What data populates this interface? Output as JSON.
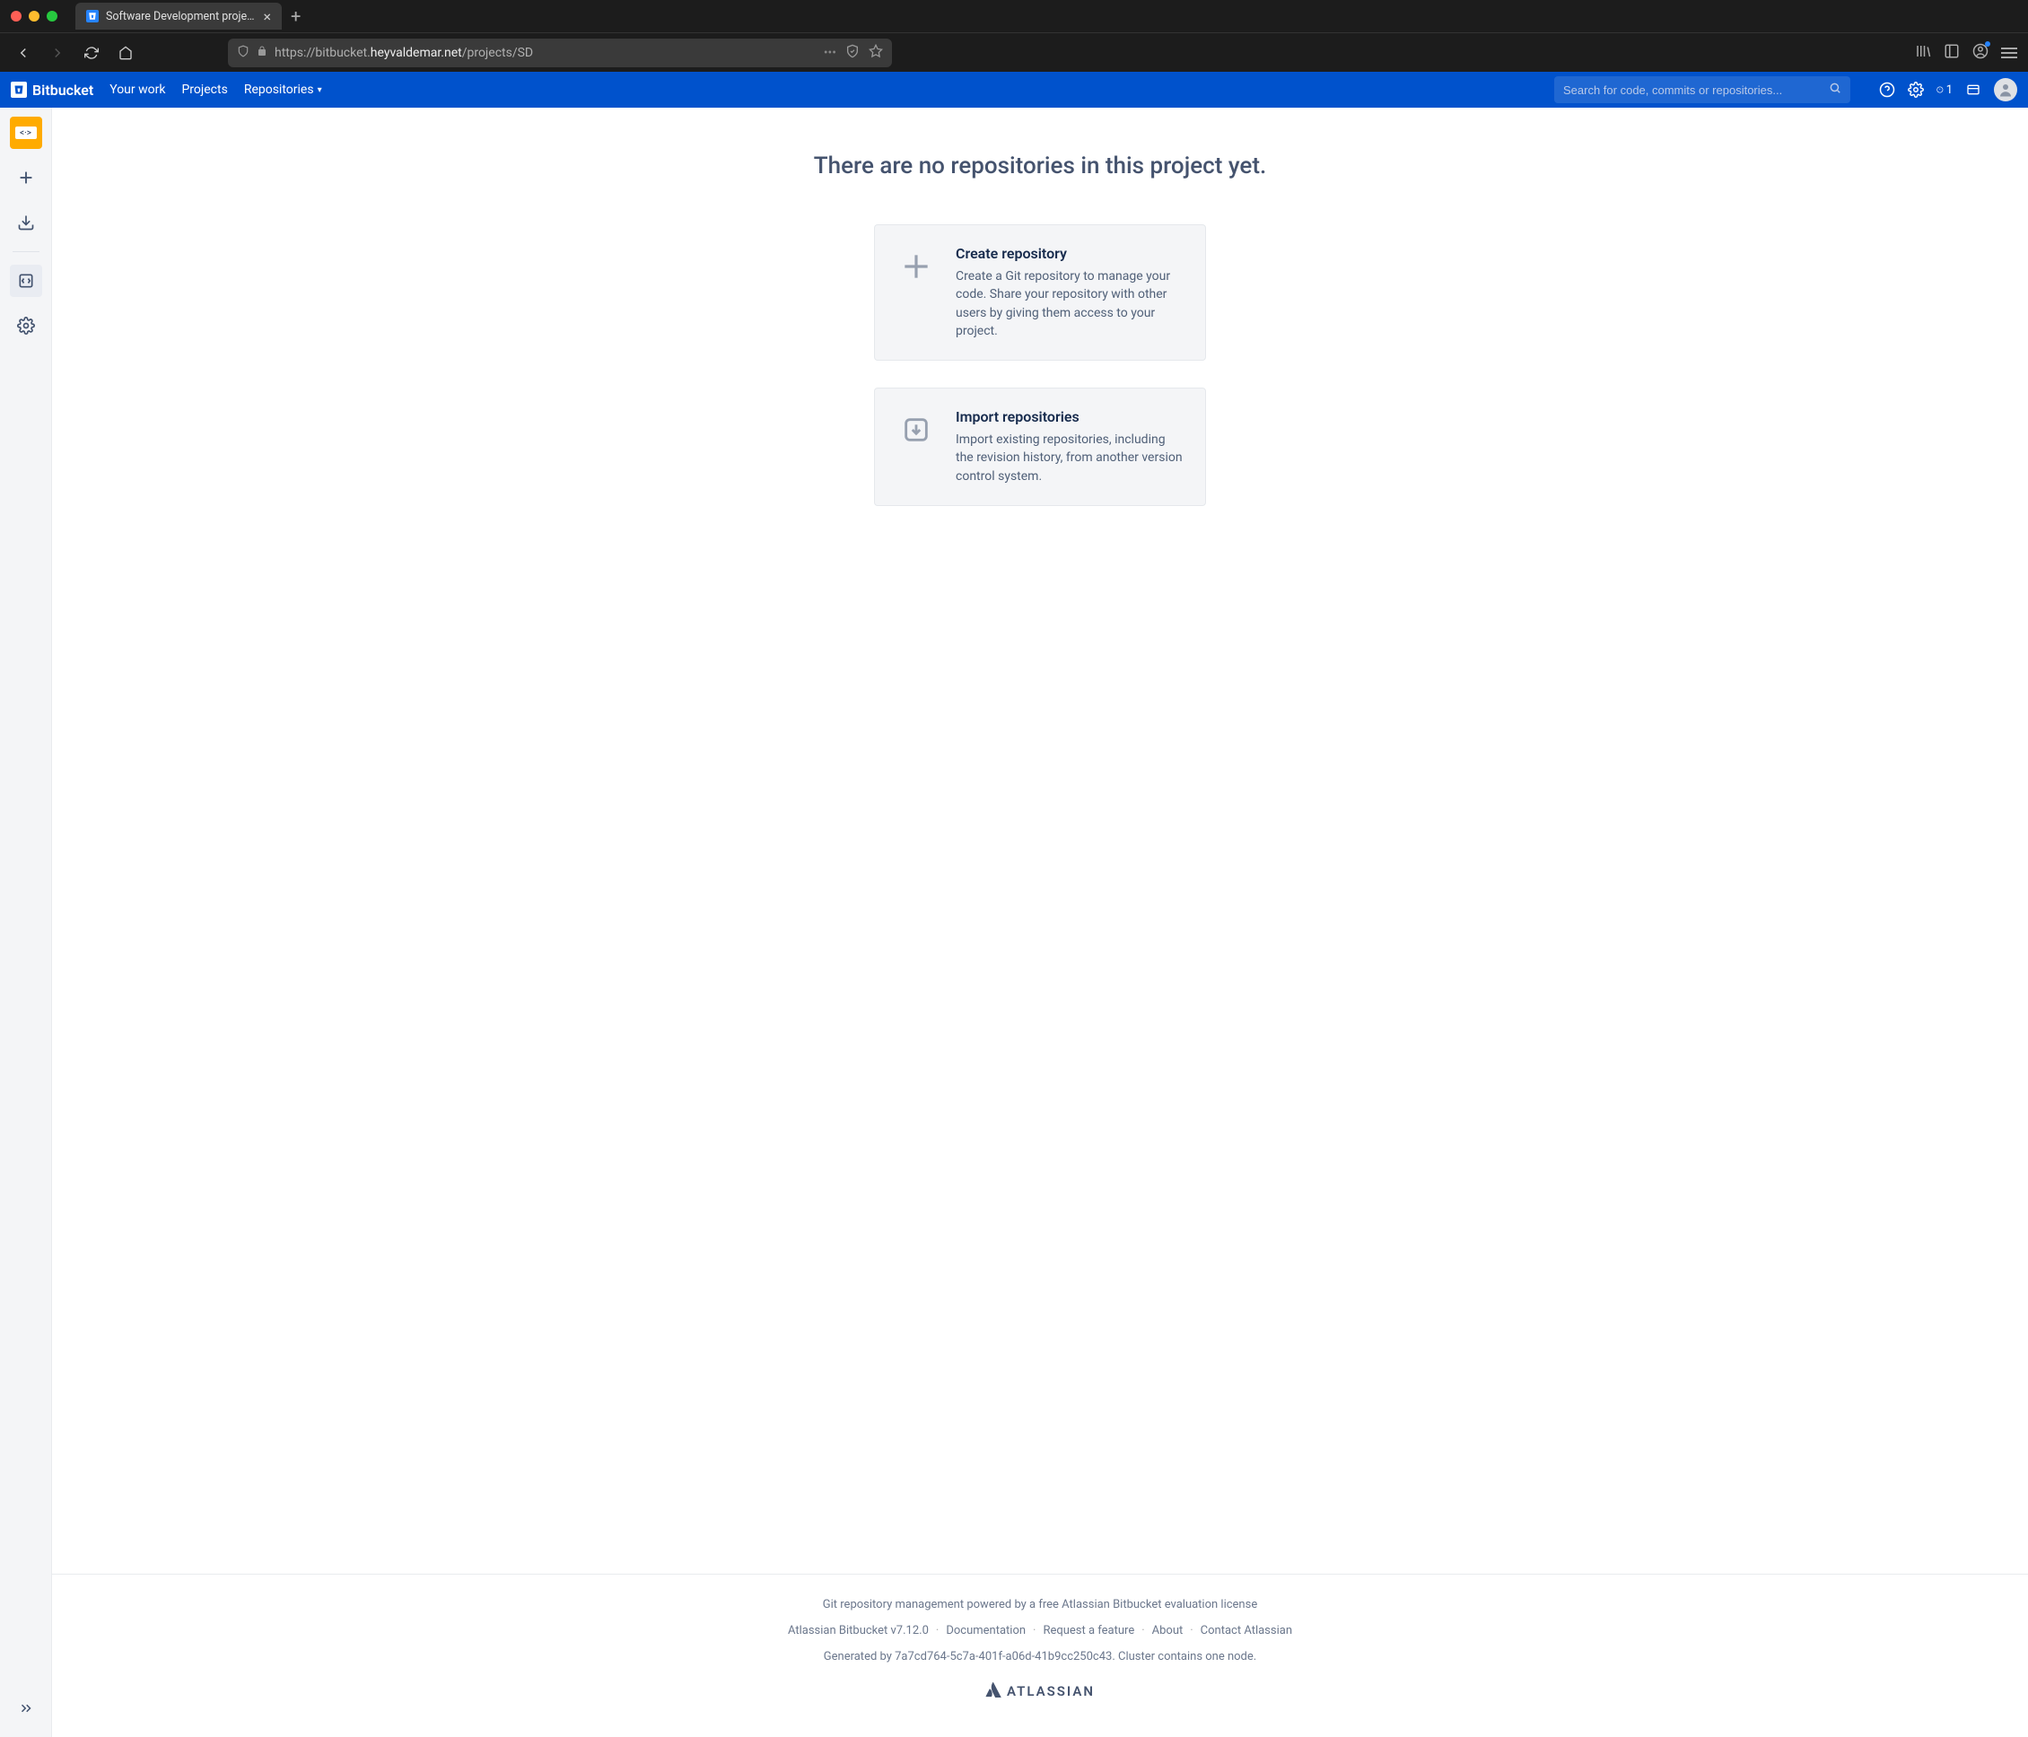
{
  "browser": {
    "tab_title": "Software Development project",
    "url_prefix": "https://bitbucket.",
    "url_domain": "heyvaldemar.net",
    "url_path": "/projects/SD"
  },
  "header": {
    "product": "Bitbucket",
    "nav": {
      "your_work": "Your work",
      "projects": "Projects",
      "repositories": "Repositories"
    },
    "search_placeholder": "Search for code, commits or repositories...",
    "inbox_count": "1"
  },
  "main": {
    "heading": "There are no repositories in this project yet.",
    "create": {
      "title": "Create repository",
      "desc": "Create a Git repository to manage your code. Share your repository with other users by giving them access to your project."
    },
    "import": {
      "title": "Import repositories",
      "desc": "Import existing repositories, including the revision history, from another version control system."
    }
  },
  "footer": {
    "powered": "Git repository management powered by a free Atlassian Bitbucket evaluation license",
    "version": "Atlassian Bitbucket v7.12.0",
    "links": {
      "documentation": "Documentation",
      "request": "Request a feature",
      "about": "About",
      "contact": "Contact Atlassian"
    },
    "generated": "Generated by 7a7cd764-5c7a-401f-a06d-41b9cc250c43. Cluster contains one node.",
    "brand": "ATLASSIAN"
  }
}
